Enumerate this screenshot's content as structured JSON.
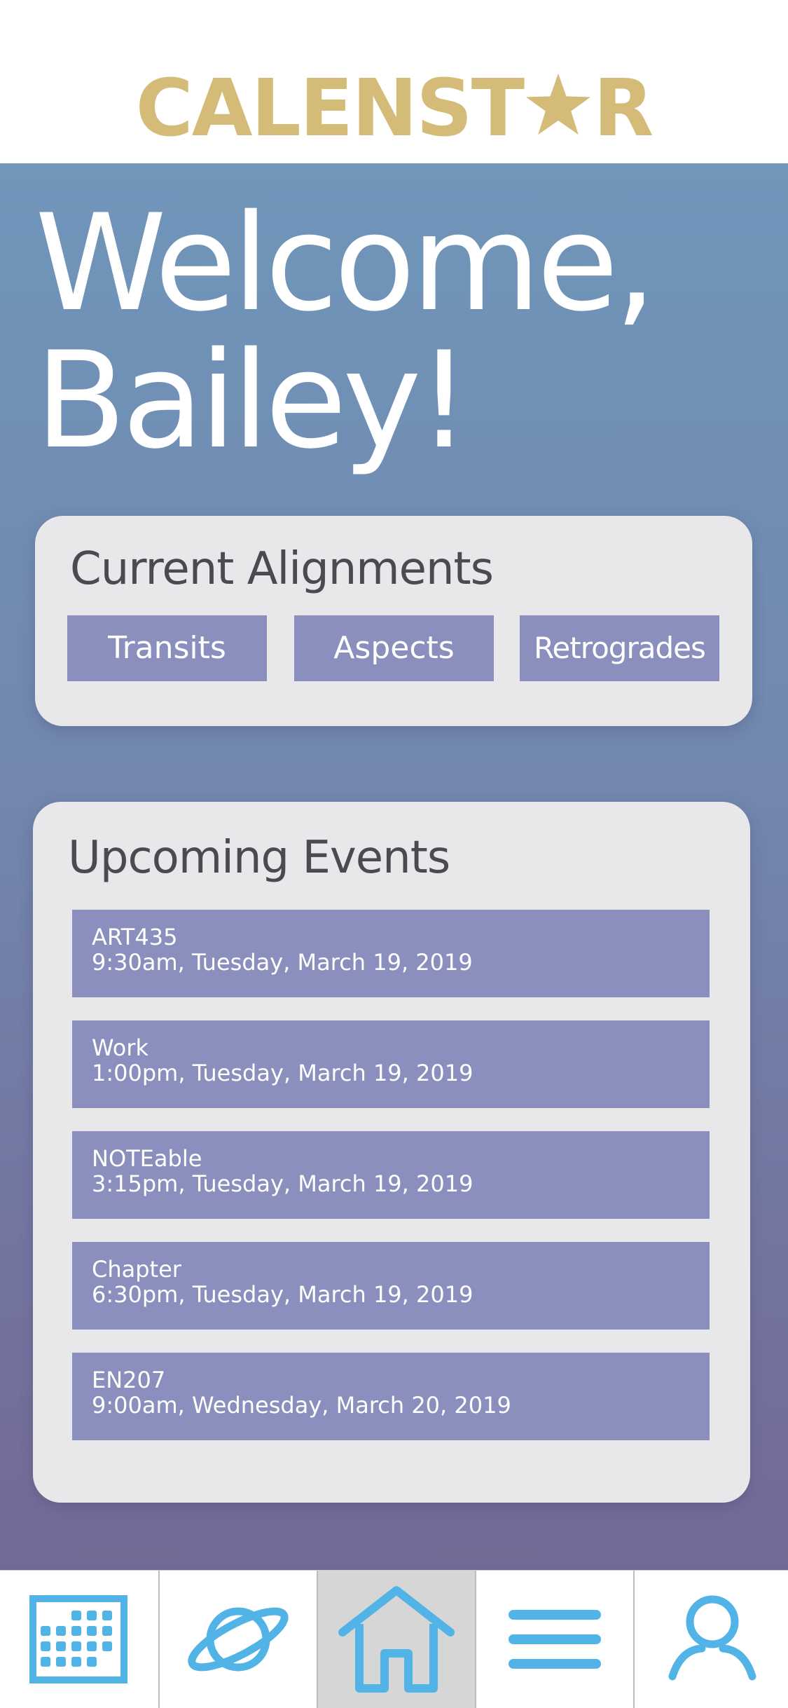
{
  "app": {
    "logo_prefix": "CALENST",
    "logo_suffix": "R",
    "brand_color": "#d4bb78"
  },
  "welcome": {
    "line1": "Welcome,",
    "line2": "Bailey!"
  },
  "alignments": {
    "title": "Current Alignments",
    "buttons": [
      {
        "label": "Transits"
      },
      {
        "label": "Aspects"
      },
      {
        "label": "Retrogrades"
      }
    ]
  },
  "events": {
    "title": "Upcoming Events",
    "items": [
      {
        "name": "ART435",
        "time": "9:30am, Tuesday, March 19, 2019"
      },
      {
        "name": "Work",
        "time": "1:00pm, Tuesday, March 19, 2019"
      },
      {
        "name": "NOTEable",
        "time": "3:15pm, Tuesday, March 19, 2019"
      },
      {
        "name": "Chapter",
        "time": "6:30pm, Tuesday, March 19, 2019"
      },
      {
        "name": "EN207",
        "time": "9:00am, Wednesday, March 20, 2019"
      }
    ]
  },
  "tabbar": {
    "tabs": [
      {
        "icon": "calendar-icon",
        "active": false
      },
      {
        "icon": "planet-icon",
        "active": false
      },
      {
        "icon": "home-icon",
        "active": true
      },
      {
        "icon": "menu-icon",
        "active": false
      },
      {
        "icon": "profile-icon",
        "active": false
      }
    ],
    "icon_color": "#52b4e6"
  },
  "colors": {
    "card_bg": "#e8e8ea",
    "button_bg": "#8a8fbd",
    "gradient_top": "#7096ba",
    "gradient_bottom": "#736996"
  }
}
